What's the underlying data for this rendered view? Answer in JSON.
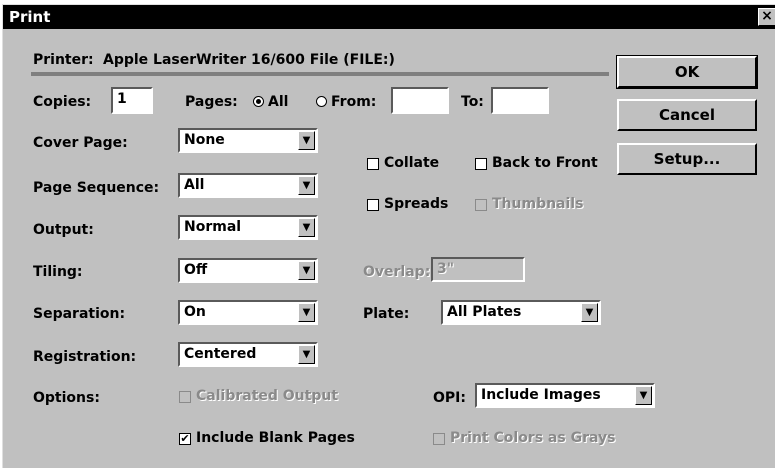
{
  "window": {
    "title": "Print",
    "close_glyph": "×"
  },
  "printer": {
    "label": "Printer:",
    "name": "Apple LaserWriter 16/600 File  (FILE:)"
  },
  "copies": {
    "label": "Copies:",
    "value": "1"
  },
  "pages": {
    "label": "Pages:",
    "all_label": "All",
    "from_label": "From:",
    "to_label": "To:",
    "from_value": "",
    "to_value": "",
    "selected": "All"
  },
  "cover_page": {
    "label": "Cover Page:",
    "value": "None"
  },
  "page_sequence": {
    "label": "Page Sequence:",
    "value": "All"
  },
  "output": {
    "label": "Output:",
    "value": "Normal"
  },
  "tiling": {
    "label": "Tiling:",
    "value": "Off"
  },
  "separation": {
    "label": "Separation:",
    "value": "On"
  },
  "registration": {
    "label": "Registration:",
    "value": "Centered"
  },
  "options": {
    "label": "Options:"
  },
  "checkboxes": {
    "collate": {
      "label": "Collate",
      "checked": false
    },
    "back_to_front": {
      "label": "Back to Front",
      "checked": false
    },
    "spreads": {
      "label": "Spreads",
      "checked": false
    },
    "thumbnails": {
      "label": "Thumbnails",
      "checked": false,
      "disabled": true
    },
    "calibrated_output": {
      "label": "Calibrated Output",
      "checked": false,
      "disabled": true
    },
    "include_blank_pages": {
      "label": "Include Blank Pages",
      "checked": true
    },
    "print_colors_as_grays": {
      "label": "Print Colors as Grays",
      "checked": false,
      "disabled": true
    }
  },
  "overlap": {
    "label": "Overlap:",
    "value": "3\""
  },
  "plate": {
    "label": "Plate:",
    "value": "All Plates"
  },
  "opi": {
    "label": "OPI:",
    "value": "Include Images"
  },
  "buttons": {
    "ok": "OK",
    "cancel": "Cancel",
    "setup": "Setup..."
  },
  "icons": {
    "dropdown": "▼",
    "check": "✔"
  },
  "colors": {
    "face": "#c0c0c0",
    "titlebar": "#000000",
    "disabled_text": "#8a8a8a"
  }
}
